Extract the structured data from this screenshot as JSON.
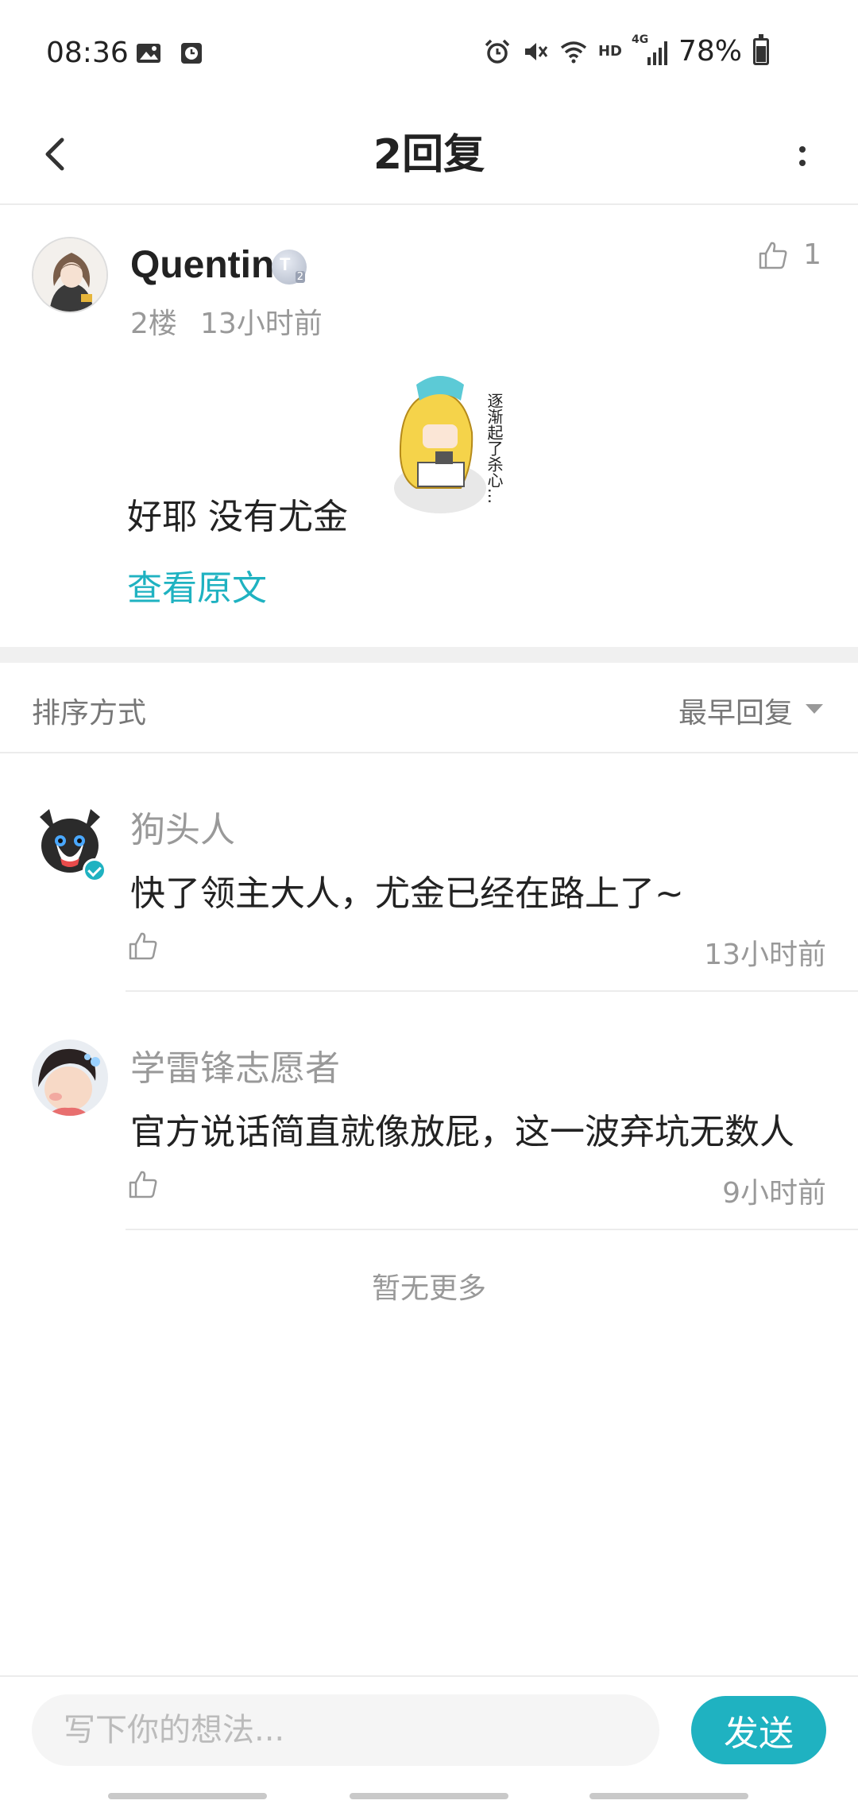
{
  "status_bar": {
    "time": "08:36",
    "battery": "78%",
    "icons_left": [
      "image-icon",
      "clock-app-icon"
    ],
    "icons_right": [
      "alarm-icon",
      "mute-icon",
      "wifi-icon",
      "hd-icon",
      "signal-icon",
      "battery-icon"
    ],
    "hd_label": "HD",
    "network_label": "4G"
  },
  "header": {
    "title": "2回复"
  },
  "post": {
    "username": "Quentin",
    "level_badge": "T",
    "level_sub": "2",
    "floor": "2楼",
    "time": "13小时前",
    "like_count": "1",
    "text": "好耶 没有尤金",
    "view_original": "查看原文",
    "sticker_caption": "逐渐起了杀心…"
  },
  "sort": {
    "label": "排序方式",
    "value": "最早回复"
  },
  "replies": [
    {
      "name": "狗头人",
      "text": "快了领主大人，尤金已经在路上了~",
      "time": "13小时前",
      "verified": true
    },
    {
      "name": "学雷锋志愿者",
      "text": "官方说话简直就像放屁，这一波弃坑无数人",
      "time": "9小时前",
      "verified": false
    }
  ],
  "no_more": "暂无更多",
  "composer": {
    "placeholder": "写下你的想法...",
    "send": "发送"
  },
  "colors": {
    "accent": "#1fb2c1",
    "muted_text": "#999999",
    "divider": "#ececec"
  }
}
